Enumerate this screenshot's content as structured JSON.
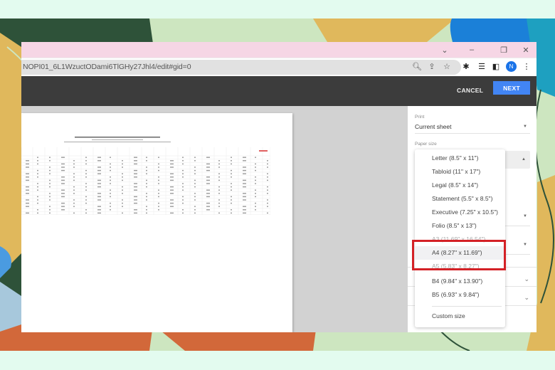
{
  "browser": {
    "url": "NOPI01_6L1WzuctODami6TlGHy27Jhl4/edit#gid=0",
    "window_controls": [
      {
        "name": "tab-search-icon",
        "glyph": "⌄"
      },
      {
        "name": "minimize-icon",
        "glyph": "–"
      },
      {
        "name": "restore-icon",
        "glyph": "❐"
      },
      {
        "name": "close-icon",
        "glyph": "✕"
      }
    ],
    "omnibox_icons": [
      {
        "name": "zoom-icon",
        "glyph": "🔍︎"
      },
      {
        "name": "share-icon",
        "glyph": "⇪"
      },
      {
        "name": "bookmark-star-icon",
        "glyph": "☆"
      }
    ],
    "toolbar_icons": [
      {
        "name": "extensions-puzzle-icon",
        "glyph": "✱"
      },
      {
        "name": "media-queue-icon",
        "glyph": "☰"
      },
      {
        "name": "side-panel-icon",
        "glyph": "◧"
      },
      {
        "name": "more-menu-icon",
        "glyph": "⋮"
      }
    ],
    "profile_initial": "N"
  },
  "print_dialog": {
    "cancel_label": "CANCEL",
    "next_label": "NEXT",
    "print_label": "Print",
    "print_value": "Current sheet",
    "paper_size_label": "Paper size",
    "paper_size_options": [
      {
        "label": "Letter (8.5\" x 11\")",
        "selected": false
      },
      {
        "label": "Tabloid (11\" x 17\")",
        "selected": false
      },
      {
        "label": "Legal (8.5\" x 14\")",
        "selected": false
      },
      {
        "label": "Statement (5.5\" x 8.5\")",
        "selected": false
      },
      {
        "label": "Executive (7.25\" x 10.5\")",
        "selected": false
      },
      {
        "label": "Folio (8.5\" x 13\")",
        "selected": false
      },
      {
        "label": "A3 (11.69\" x 16.54\")",
        "selected": false
      },
      {
        "label": "A4 (8.27\" x 11.69\")",
        "selected": true
      },
      {
        "label": "A5 (5.83\" x 8.27\")",
        "selected": false
      },
      {
        "label": "B4 (9.84\" x 13.90\")",
        "selected": false
      },
      {
        "label": "B5 (6.93\" x 9.84\")",
        "selected": false
      }
    ],
    "custom_size_label": "Custom size"
  },
  "annotation": {
    "highlight_color": "#d42126",
    "highlighted_option": "A4 (8.27\" x 11.69\")"
  },
  "colors": {
    "accent": "#4285f4",
    "toolbar": "#3c3c3c",
    "titlebar": "#f6d6e5",
    "profile": "#1a73e8"
  }
}
